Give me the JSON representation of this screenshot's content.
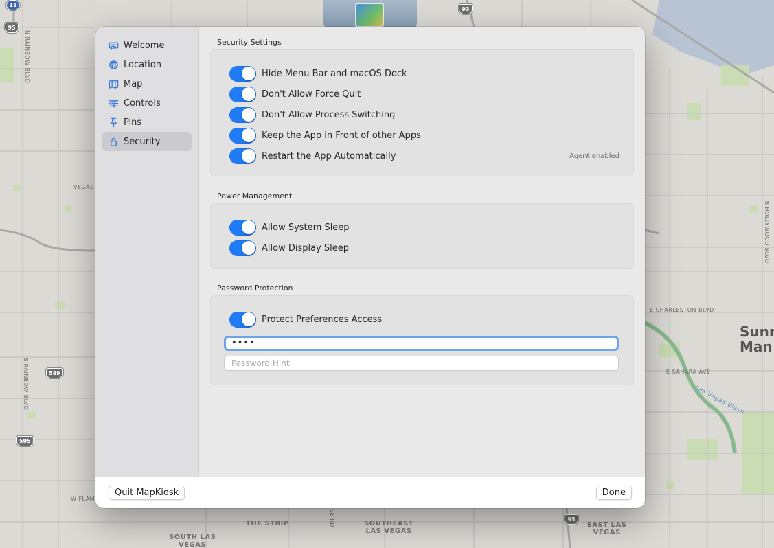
{
  "map": {
    "labels": {
      "n_rainbow": "N RAINBOW BLVD",
      "s_rainbow": "S RAINBOW BLVD",
      "vegas": "VEGAS",
      "w_flam": "W FLAM",
      "the_strip": "THE STRIP",
      "southeast": "SOUTHEAST\nLAS VEGAS",
      "east_las_vegas": "EAST LAS\nVEGAS",
      "south_las": "SOUTH LAS\nVEGAS",
      "e_charleston": "E CHARLESTON BLVD",
      "e_sahara": "E SAHARA AVE",
      "n_hollywood": "N HOLLYWOOD BLVD",
      "sunrise": "Sunr\nMan",
      "las_vegas_wash": "Las Vegas Wash",
      "se_rd": "SE RD"
    },
    "shields": {
      "i11": "11",
      "us95_top": "95",
      "us93": "93",
      "sr589": "589",
      "sr595": "595",
      "us95_bottom": "95"
    }
  },
  "sidebar": {
    "items": [
      {
        "label": "Welcome",
        "icon": "chat-bubble-icon"
      },
      {
        "label": "Location",
        "icon": "globe-icon"
      },
      {
        "label": "Map",
        "icon": "map-icon"
      },
      {
        "label": "Controls",
        "icon": "sliders-icon"
      },
      {
        "label": "Pins",
        "icon": "pin-icon"
      },
      {
        "label": "Security",
        "icon": "lock-icon",
        "selected": true
      }
    ]
  },
  "security": {
    "title": "Security Settings",
    "toggles": [
      {
        "label": "Hide Menu Bar and macOS Dock",
        "on": true
      },
      {
        "label": "Don't Allow Force Quit",
        "on": true
      },
      {
        "label": "Don't Allow Process Switching",
        "on": true
      },
      {
        "label": "Keep the App in Front of other Apps",
        "on": true
      },
      {
        "label": "Restart the App Automatically",
        "on": true
      }
    ],
    "restart_note": "Agent enabled"
  },
  "power": {
    "title": "Power Management",
    "toggles": [
      {
        "label": "Allow System Sleep",
        "on": true
      },
      {
        "label": "Allow Display Sleep",
        "on": true
      }
    ]
  },
  "password": {
    "title": "Password Protection",
    "toggle": {
      "label": "Protect Preferences Access",
      "on": true
    },
    "field_value": "••••",
    "hint_placeholder": "Password Hint",
    "hint_value": ""
  },
  "footer": {
    "quit_label": "Quit MapKiosk",
    "done_label": "Done"
  },
  "colors": {
    "accent": "#1f7cf6",
    "icon_blue": "#3a78d8",
    "focus_ring": "#6ba4e8"
  }
}
